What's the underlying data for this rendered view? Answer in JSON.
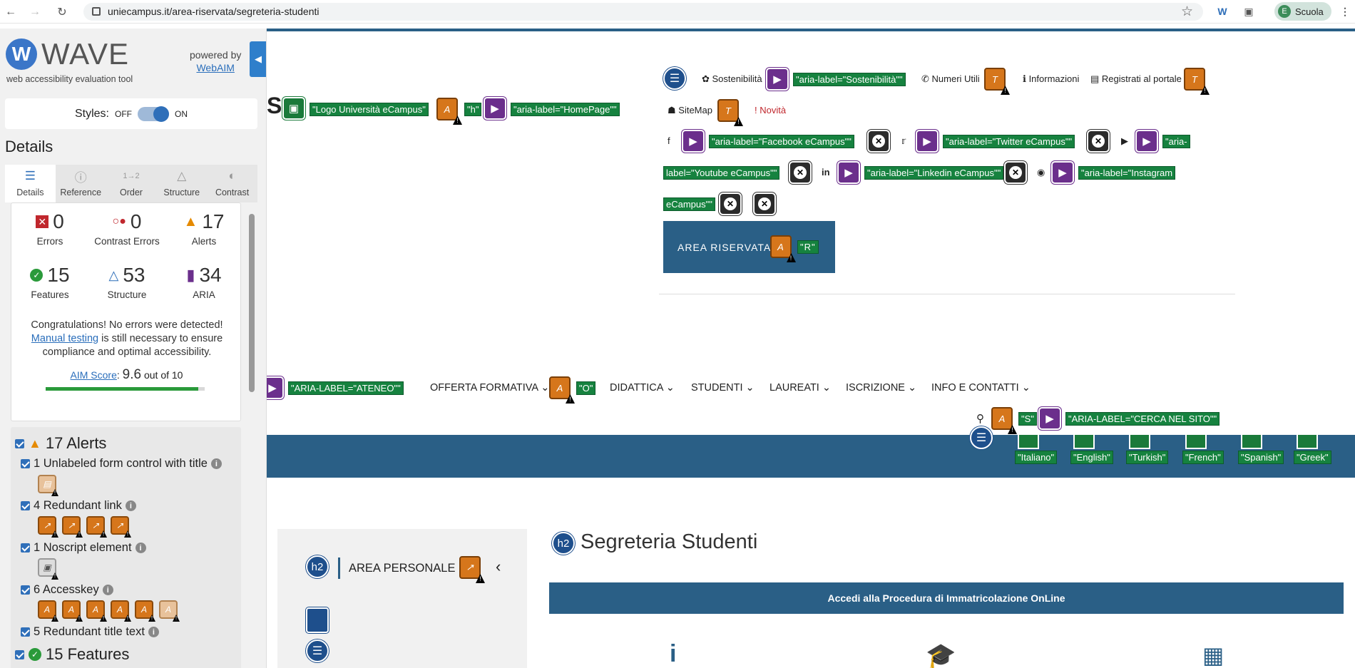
{
  "browser": {
    "url": "uniecampus.it/area-riservata/segreteria-studenti",
    "profile_initial": "E",
    "profile_name": "Scuola"
  },
  "wave": {
    "logo_letter": "W",
    "title": "WAVE",
    "subtitle": "web accessibility evaluation tool",
    "powered_by": "powered by",
    "webaim": "WebAIM",
    "styles_label": "Styles:",
    "off": "OFF",
    "on": "ON",
    "details_heading": "Details",
    "tabs": [
      "Details",
      "Reference",
      "Order",
      "Structure",
      "Contrast"
    ],
    "summary": {
      "errors": {
        "value": "0",
        "label": "Errors"
      },
      "contrast": {
        "value": "0",
        "label": "Contrast Errors"
      },
      "alerts": {
        "value": "17",
        "label": "Alerts"
      },
      "features": {
        "value": "15",
        "label": "Features"
      },
      "structure": {
        "value": "53",
        "label": "Structure"
      },
      "aria": {
        "value": "34",
        "label": "ARIA"
      }
    },
    "congrats": "Congratulations! No errors were detected!",
    "manual_testing": "Manual testing",
    "congrats_rest": "is still necessary to ensure compliance and optimal accessibility.",
    "aim_label": "AIM Score",
    "aim_score": "9.6",
    "aim_outof": "out of 10",
    "aim_fraction": 0.96,
    "alerts_heading": "17 Alerts",
    "alerts": [
      {
        "label": "1 Unlabeled form control with title",
        "count": 1
      },
      {
        "label": "4 Redundant link",
        "count": 4
      },
      {
        "label": "1 Noscript element",
        "count": 1
      },
      {
        "label": "6 Accesskey",
        "count": 6
      },
      {
        "label": "5 Redundant title text",
        "count": 5
      }
    ],
    "features_heading": "15 Features"
  },
  "page": {
    "logo_letter": "S",
    "logo_label": "\"Logo Università eCampus\"",
    "h_label": "\"h\"",
    "homepage_label": "\"aria-label=\"HomePage\"\"",
    "top_links": {
      "sostenibilita": "Sostenibilità",
      "sostenibilita_aria": "\"aria-label=\"Sostenibilità\"\"",
      "numeri": "Numeri Utili",
      "informazioni": "Informazioni",
      "registrati": "Registrati al portale",
      "sitemap": "SiteMap",
      "novita": "Novità"
    },
    "social": {
      "facebook": "\"aria-label=\"Facebook eCampus\"\"",
      "twitter": "\"aria-label=\"Twitter eCampus\"\"",
      "youtube_a": "\"aria-",
      "youtube_b": "label=\"Youtube eCampus\"\"",
      "linkedin": "\"aria-label=\"Linkedin eCampus\"\"",
      "instagram_a": "\"aria-label=\"Instagram",
      "instagram_b": "eCampus\"\""
    },
    "area_riservata": "AREA RISERVATA",
    "r_label": "\"R\"",
    "ateneo_label": "\"ARIA-LABEL=\"ATENEO\"\"",
    "menu": [
      "OFFERTA FORMATIVA",
      "DIDATTICA",
      "STUDENTI",
      "LAUREATI",
      "ISCRIZIONE",
      "INFO E CONTATTI"
    ],
    "o_label": "\"O\"",
    "s_label": "\"S\"",
    "search_label": "\"ARIA-LABEL=\"CERCA NEL SITO\"\"",
    "languages": [
      "\"Italiano\"",
      "\"English\"",
      "\"Turkish\"",
      "\"French\"",
      "\"Spanish\"",
      "\"Greek\""
    ],
    "area_personale": "AREA PERSONALE",
    "h2": "h2",
    "heading": "Segreteria Studenti",
    "accedi": "Accedi alla Procedura di Immatricolazione OnLine"
  }
}
